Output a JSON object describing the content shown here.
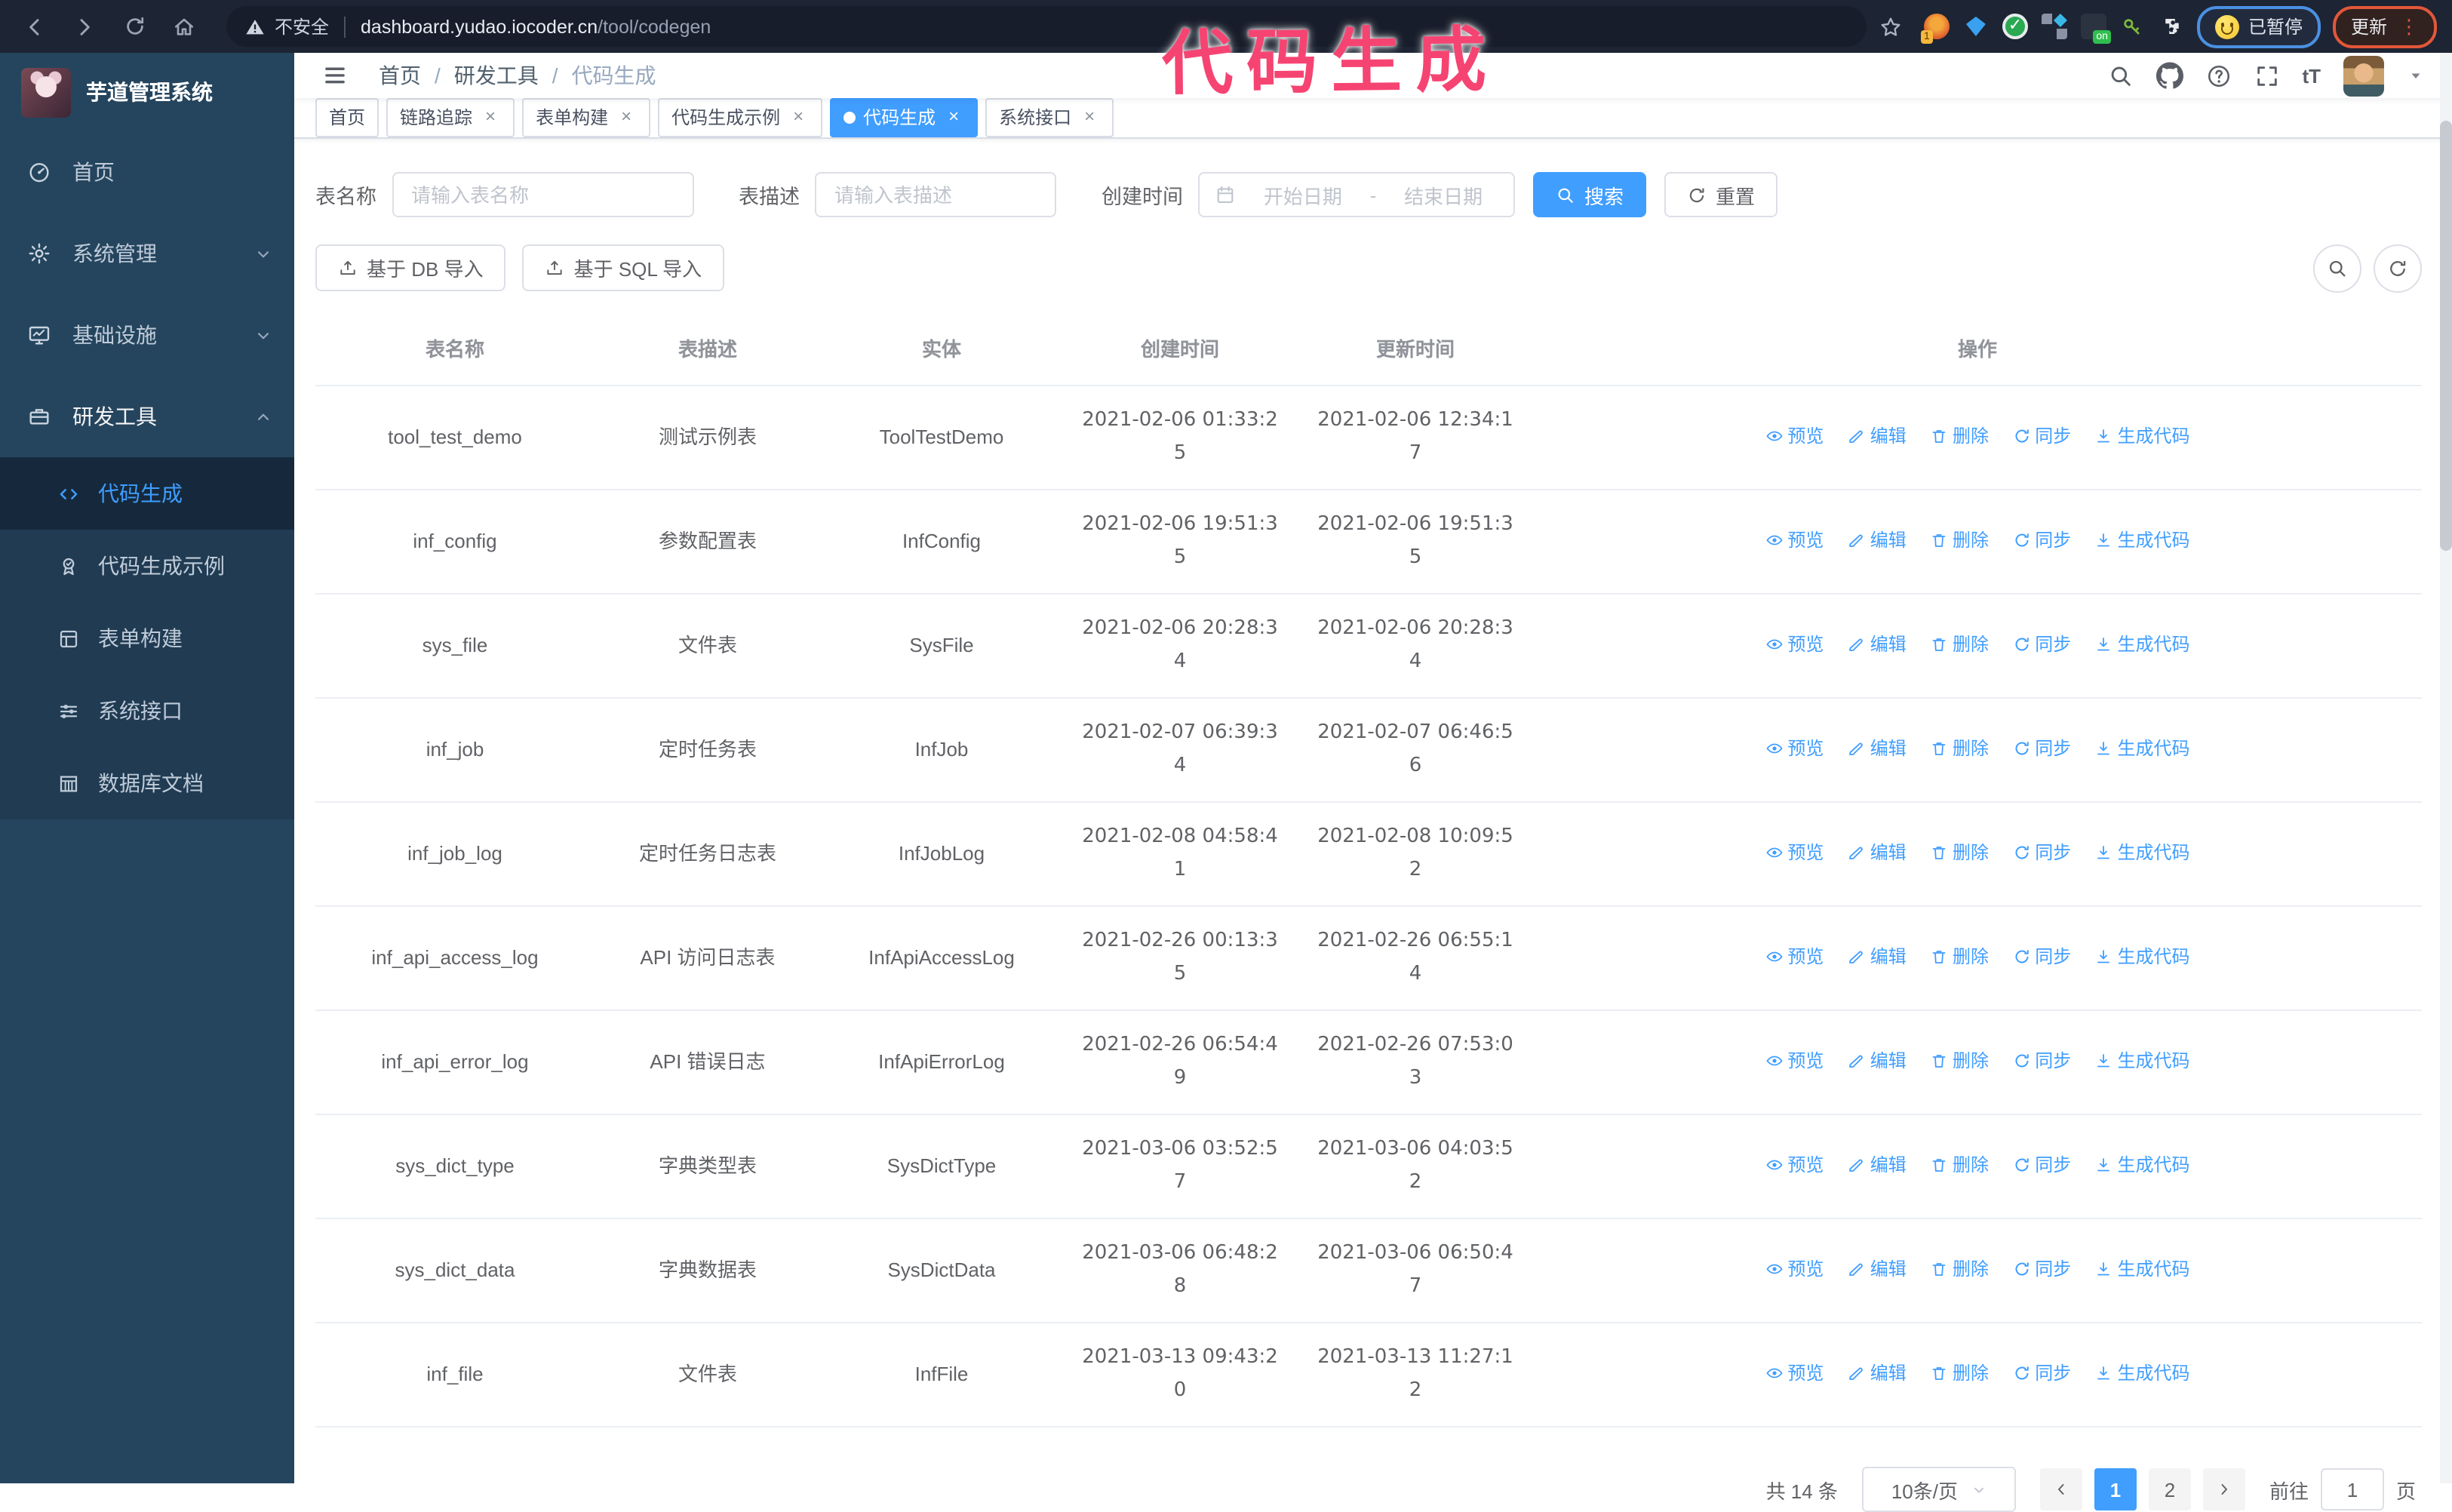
{
  "browser": {
    "security_label": "不安全",
    "url_domain": "dashboard.yudao.iocoder.cn",
    "url_path": "/tool/codegen",
    "ext_badge_1": "1",
    "ext_badge_on": "on",
    "ext_check": "✓",
    "profile_status": "已暂停",
    "update_label": "更新"
  },
  "annotation": {
    "text": "代码生成"
  },
  "icons": {
    "close": "×",
    "ellipsis": "⋮",
    "text_size": "tT"
  },
  "sidebar": {
    "logo_title": "芋道管理系统",
    "items": [
      {
        "label": "首页"
      },
      {
        "label": "系统管理"
      },
      {
        "label": "基础设施"
      },
      {
        "label": "研发工具"
      }
    ],
    "sub_items": [
      {
        "label": "代码生成"
      },
      {
        "label": "代码生成示例"
      },
      {
        "label": "表单构建"
      },
      {
        "label": "系统接口"
      },
      {
        "label": "数据库文档"
      }
    ]
  },
  "breadcrumb": {
    "separator": "/",
    "items": [
      "首页",
      "研发工具",
      "代码生成"
    ]
  },
  "tabs": [
    {
      "label": "首页"
    },
    {
      "label": "链路追踪"
    },
    {
      "label": "表单构建"
    },
    {
      "label": "代码生成示例"
    },
    {
      "label": "代码生成"
    },
    {
      "label": "系统接口"
    }
  ],
  "filters": {
    "table_name_label": "表名称",
    "table_name_placeholder": "请输入表名称",
    "table_desc_label": "表描述",
    "table_desc_placeholder": "请输入表描述",
    "create_time_label": "创建时间",
    "date_start_placeholder": "开始日期",
    "date_separator": "-",
    "date_end_placeholder": "结束日期",
    "search_label": "搜索",
    "reset_label": "重置"
  },
  "toolbar": {
    "import_db_label": "基于 DB 导入",
    "import_sql_label": "基于 SQL 导入"
  },
  "table": {
    "columns": [
      "表名称",
      "表描述",
      "实体",
      "创建时间",
      "更新时间",
      "操作"
    ],
    "action_labels": [
      "预览",
      "编辑",
      "删除",
      "同步",
      "生成代码"
    ],
    "rows": [
      {
        "name": "tool_test_demo",
        "desc": "测试示例表",
        "entity": "ToolTestDemo",
        "created": "2021-02-06 01:33:25",
        "updated": "2021-02-06 12:34:17"
      },
      {
        "name": "inf_config",
        "desc": "参数配置表",
        "entity": "InfConfig",
        "created": "2021-02-06 19:51:35",
        "updated": "2021-02-06 19:51:35"
      },
      {
        "name": "sys_file",
        "desc": "文件表",
        "entity": "SysFile",
        "created": "2021-02-06 20:28:34",
        "updated": "2021-02-06 20:28:34"
      },
      {
        "name": "inf_job",
        "desc": "定时任务表",
        "entity": "InfJob",
        "created": "2021-02-07 06:39:34",
        "updated": "2021-02-07 06:46:56"
      },
      {
        "name": "inf_job_log",
        "desc": "定时任务日志表",
        "entity": "InfJobLog",
        "created": "2021-02-08 04:58:41",
        "updated": "2021-02-08 10:09:52"
      },
      {
        "name": "inf_api_access_log",
        "desc": "API 访问日志表",
        "entity": "InfApiAccessLog",
        "created": "2021-02-26 00:13:35",
        "updated": "2021-02-26 06:55:14"
      },
      {
        "name": "inf_api_error_log",
        "desc": "API 错误日志",
        "entity": "InfApiErrorLog",
        "created": "2021-02-26 06:54:49",
        "updated": "2021-02-26 07:53:03"
      },
      {
        "name": "sys_dict_type",
        "desc": "字典类型表",
        "entity": "SysDictType",
        "created": "2021-03-06 03:52:57",
        "updated": "2021-03-06 04:03:52"
      },
      {
        "name": "sys_dict_data",
        "desc": "字典数据表",
        "entity": "SysDictData",
        "created": "2021-03-06 06:48:28",
        "updated": "2021-03-06 06:50:47"
      },
      {
        "name": "inf_file",
        "desc": "文件表",
        "entity": "InfFile",
        "created": "2021-03-13 09:43:20",
        "updated": "2021-03-13 11:27:12"
      }
    ]
  },
  "pagination": {
    "total_text": "共 14 条",
    "page_size": "10条/页",
    "pages": [
      "1",
      "2"
    ],
    "active_page": "1",
    "goto_label": "前往",
    "goto_value": "1",
    "page_unit": "页"
  }
}
